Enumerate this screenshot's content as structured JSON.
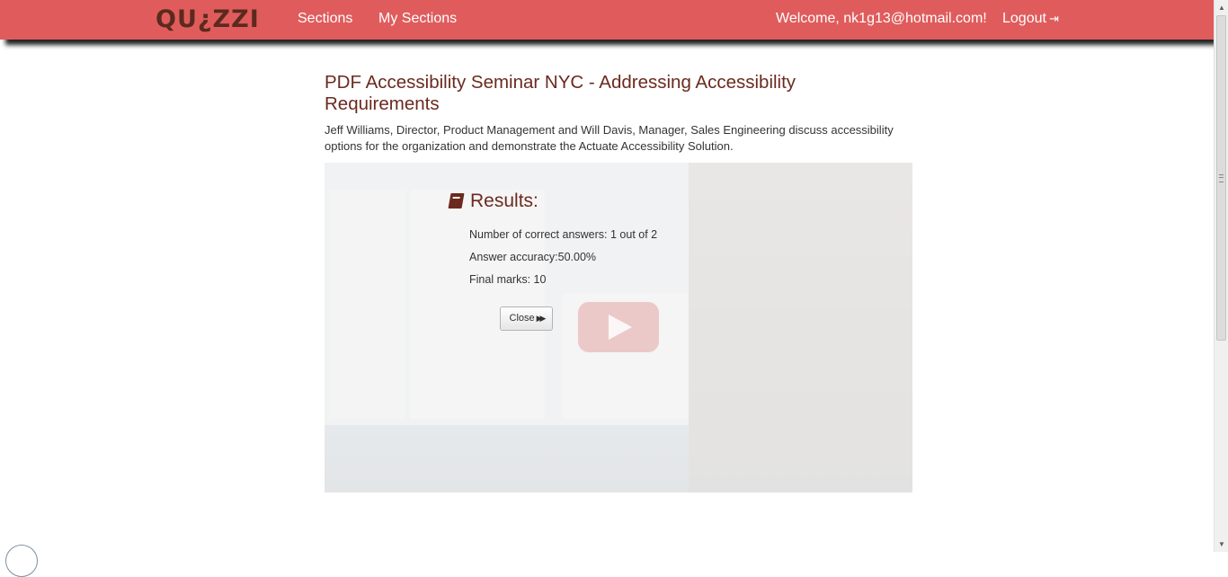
{
  "nav": {
    "logo_text": "QU¿ZZI",
    "sections": "Sections",
    "my_sections": "My Sections",
    "welcome": "Welcome, nk1g13@hotmail.com!",
    "logout": "Logout",
    "logout_icon": "sign-out-icon",
    "color_bar": "#e05c5c"
  },
  "page": {
    "title": "PDF Accessibility Seminar NYC - Addressing Accessibility Requirements",
    "description": "Jeff Williams, Director, Product Management and Will Davis, Manager, Sales Engineering discuss accessibility options for the organization and demonstrate the Actuate Accessibility Solution."
  },
  "results": {
    "icon": "book-icon",
    "heading": "Results:",
    "correct_answers": "Number of correct answers: 1 out of 2",
    "accuracy": "Answer accuracy:50.00%",
    "final_marks": "Final marks: 10",
    "close_label": "Close",
    "close_icon": "fast-forward-icon"
  },
  "video": {
    "play_icon": "play-icon"
  }
}
